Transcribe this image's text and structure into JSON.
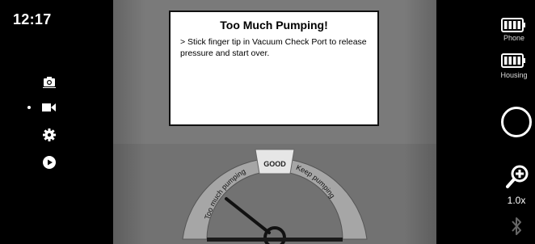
{
  "status": {
    "time": "12:17"
  },
  "mode_menu": {
    "selected": "video",
    "items": [
      {
        "name": "photo",
        "icon": "camera-icon"
      },
      {
        "name": "video",
        "icon": "video-camera-icon"
      },
      {
        "name": "settings",
        "icon": "gear-icon"
      },
      {
        "name": "playback",
        "icon": "play-icon"
      }
    ]
  },
  "dialog": {
    "title": "Too Much Pumping!",
    "body": "> Stick finger tip in Vacuum Check Port to release pressure and start over."
  },
  "gauge": {
    "left_label": "Too much pumping",
    "center_label": "GOOD",
    "right_label": "Keep pumping",
    "needle_zone": "Too much pumping"
  },
  "status_right": {
    "batteries": [
      {
        "label": "Phone",
        "level": 1.0
      },
      {
        "label": "Housing",
        "level": 1.0
      }
    ],
    "zoom": "1.0x",
    "zoom_icon": "zoom-in-icon",
    "bluetooth_icon": "bluetooth-icon",
    "bluetooth_connected": false
  }
}
